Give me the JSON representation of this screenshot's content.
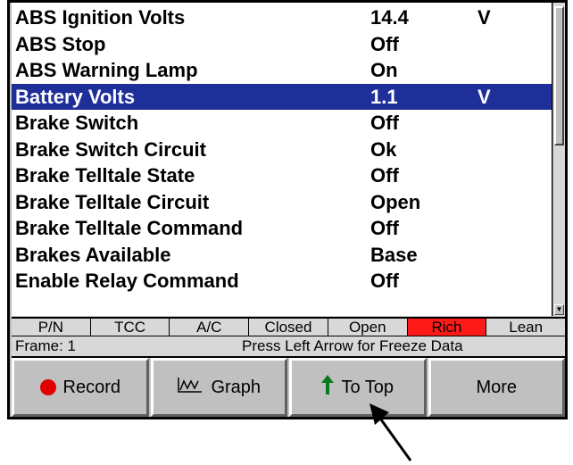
{
  "pid_list": {
    "rows": [
      {
        "name": "ABS Ignition Volts",
        "value": "14.4",
        "unit": "V"
      },
      {
        "name": "ABS Stop",
        "value": "Off",
        "unit": ""
      },
      {
        "name": "ABS Warning Lamp",
        "value": "On",
        "unit": ""
      },
      {
        "name": "Battery Volts",
        "value": "1.1",
        "unit": "V",
        "selected": true
      },
      {
        "name": "Brake Switch",
        "value": "Off",
        "unit": ""
      },
      {
        "name": "Brake Switch Circuit",
        "value": "Ok",
        "unit": ""
      },
      {
        "name": "Brake Telltale State",
        "value": "Off",
        "unit": ""
      },
      {
        "name": "Brake Telltale Circuit",
        "value": "Open",
        "unit": ""
      },
      {
        "name": "Brake Telltale Command",
        "value": "Off",
        "unit": ""
      },
      {
        "name": "Brakes Available",
        "value": "Base",
        "unit": ""
      },
      {
        "name": "Enable Relay Command",
        "value": "Off",
        "unit": ""
      }
    ],
    "selected_color": "#1f2f9a"
  },
  "status_bar": {
    "cells": [
      {
        "label": "P/N",
        "active": false
      },
      {
        "label": "TCC",
        "active": false
      },
      {
        "label": "A/C",
        "active": false
      },
      {
        "label": "Closed",
        "active": false
      },
      {
        "label": "Open",
        "active": false
      },
      {
        "label": "Rich",
        "active": true
      },
      {
        "label": "Lean",
        "active": false
      }
    ],
    "active_color": "#ff1a1a"
  },
  "info_bar": {
    "frame_label": "Frame: 1",
    "hint": "Press Left Arrow for Freeze Data"
  },
  "soft_keys": [
    {
      "label": "Record",
      "icon": "record-dot-icon"
    },
    {
      "label": "Graph",
      "icon": "graph-icon"
    },
    {
      "label": "To Top",
      "icon": "up-arrow-icon"
    },
    {
      "label": "More",
      "icon": ""
    }
  ]
}
